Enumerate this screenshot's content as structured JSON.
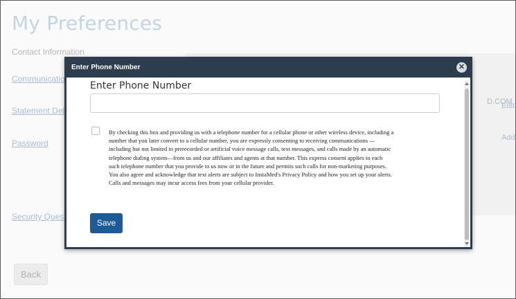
{
  "page": {
    "title": "My Preferences",
    "contact_label": "Contact Information",
    "links": {
      "communication": "Communication Preferences",
      "statement": "Statement Delivery",
      "password": "Password",
      "security": "Security Questions"
    },
    "email_fragment": "D.COM",
    "edit_link": "Edit",
    "add_link": "Add",
    "back_label": "Back"
  },
  "modal": {
    "header_title": "Enter Phone Number",
    "close_glyph": "✕",
    "field_label": "Enter Phone Number",
    "phone_value": "",
    "phone_placeholder": "",
    "consent_text": "By checking this box and providing us with a telephone number for a cellular phone or other wireless device, including a number that you later convert to a cellular number, you are expressly consenting to receiving communications — including but not limited to prerecorded or artificial voice message calls, text messages, and calls made by an automatic telephone dialing system—from us and our affiliates and agents at that number. This express consent applies to each such telephone number that you provide to us now or in the future and permits such calls for non-marketing purposes. You also agree and acknowledge that text alerts are subject to InstaMed's Privacy Policy and how you set up your alerts. Calls and messages may incur access fees from your cellular provider.",
    "consent_checked": false,
    "save_label": "Save"
  },
  "colors": {
    "modal_header": "#2e3c4f",
    "save_button": "#1d5a96",
    "link": "#a9bdd4"
  }
}
